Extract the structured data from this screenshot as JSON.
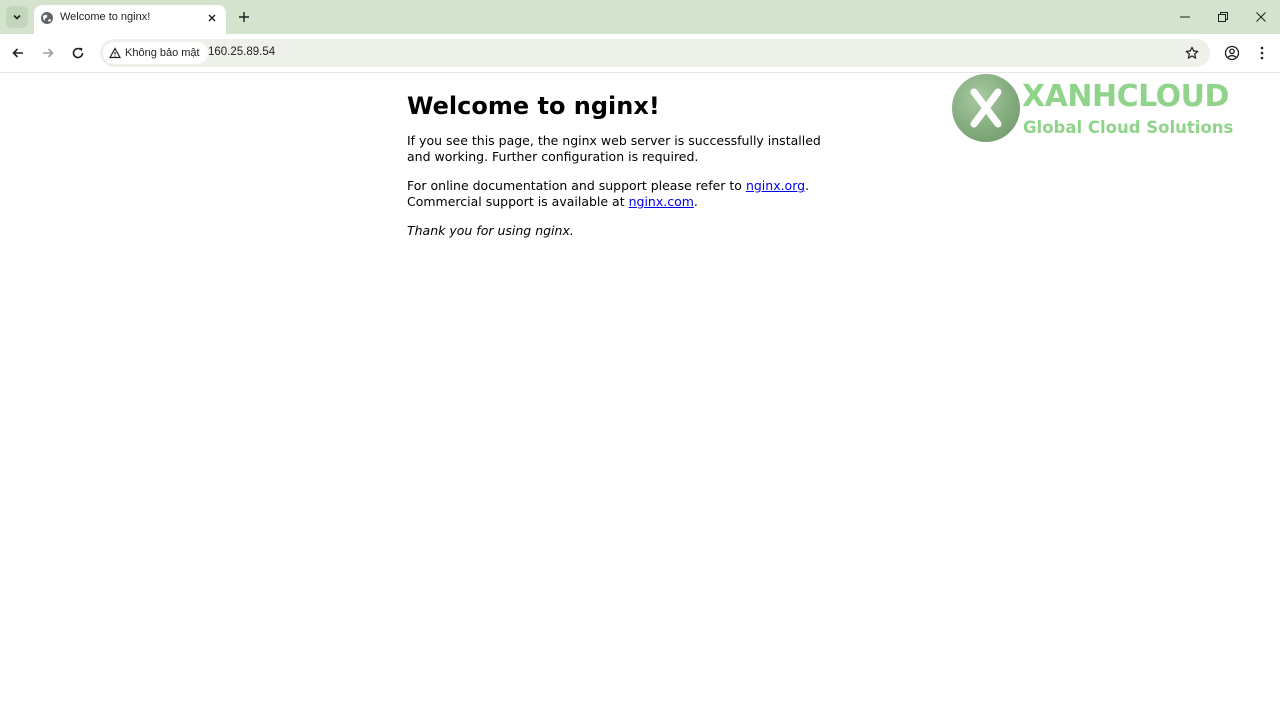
{
  "browser": {
    "tab": {
      "title": "Welcome to nginx!",
      "favicon": "globe-icon"
    },
    "toolbar": {
      "security_label": "Không bảo mật",
      "url": "160.25.89.54"
    }
  },
  "page": {
    "heading": "Welcome to nginx!",
    "intro": "If you see this page, the nginx web server is successfully installed and working. Further configuration is required.",
    "docs_prefix": "For online documentation and support please refer to ",
    "docs_link": "nginx.org",
    "docs_suffix": ".",
    "commercial_prefix": "Commercial support is available at ",
    "commercial_link": "nginx.com",
    "commercial_suffix": ".",
    "thanks": "Thank you for using nginx."
  },
  "watermark": {
    "brand": "XANHCLOUD",
    "tagline": "Global Cloud Solutions",
    "color": "#8fd48a"
  },
  "colors": {
    "tabstrip": "#d3e3cd",
    "omnibox": "#eef1ea",
    "link": "#0000ee"
  }
}
